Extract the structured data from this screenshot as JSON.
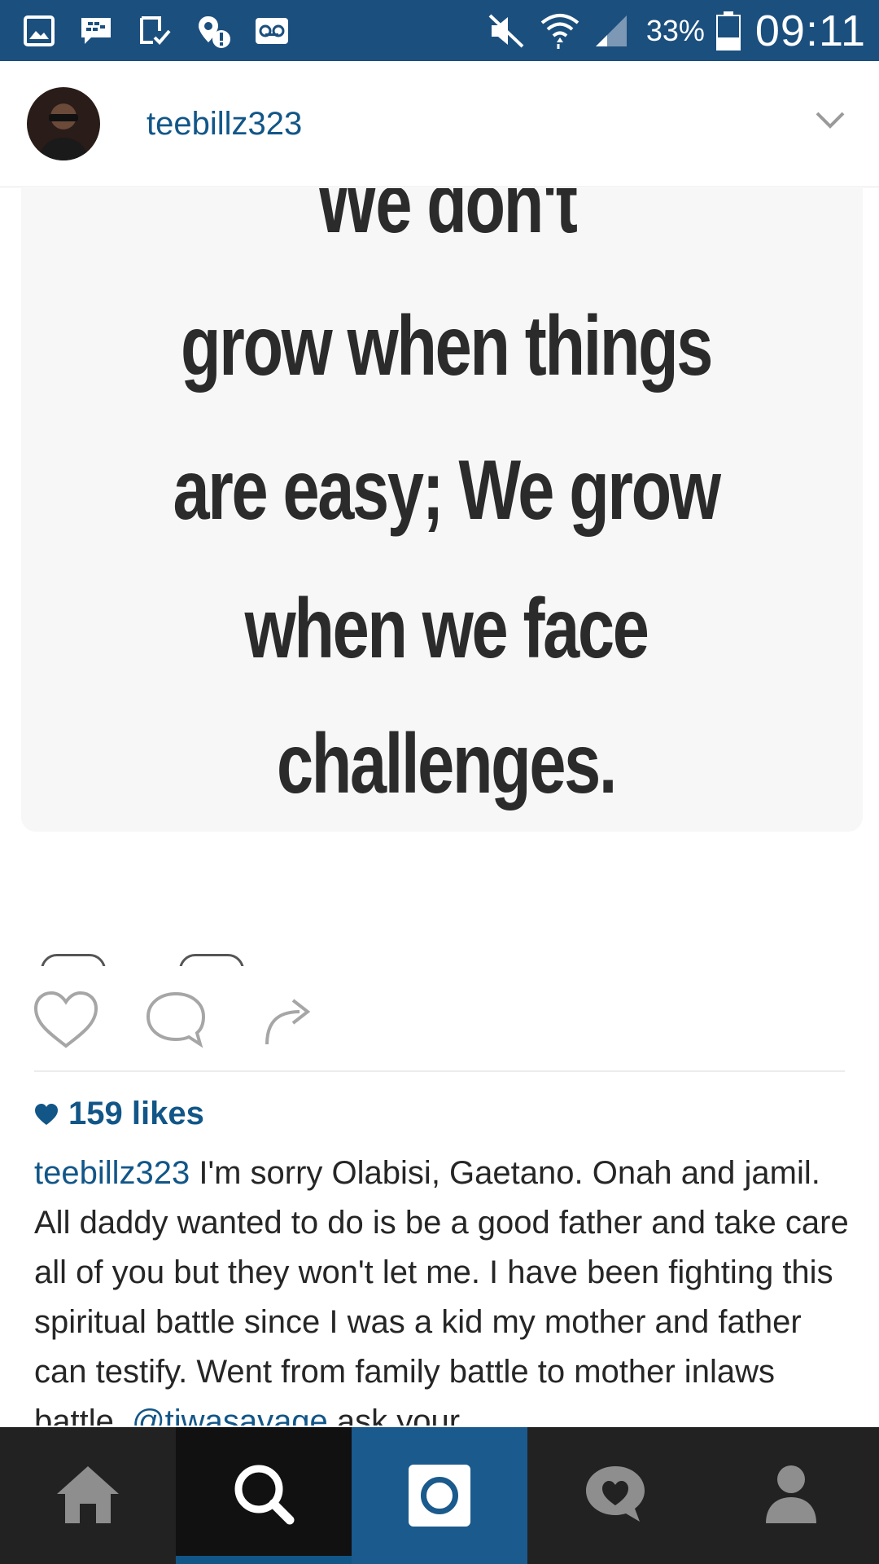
{
  "status_bar": {
    "left_icons": [
      "gallery-icon",
      "bbm-icon",
      "download-done-icon",
      "location-alert-icon",
      "voicemail-icon"
    ],
    "right_icons": [
      "mute-icon",
      "wifi-icon",
      "signal-icon",
      "battery-icon"
    ],
    "battery": "33%",
    "time": "09:11"
  },
  "post": {
    "username": "teebillz323",
    "image_quote_lines": [
      "We don't",
      "grow when things",
      "are easy; We grow",
      "when we face",
      "challenges."
    ],
    "likes": "159 likes",
    "caption_user": "teebillz323",
    "caption_text": " I'm sorry Olabisi, Gaetano. Onah and jamil. All daddy wanted to do is be a good father and take care all of you but they won't let me. I have been fighting this spiritual battle since I was a kid my mother and father can testify. Went from family battle to mother inlaws battle. ",
    "caption_mention": "@tiwasavage",
    "caption_tail": " ask your"
  },
  "bottom_nav": [
    "home-icon",
    "search-icon",
    "camera-icon",
    "activity-icon",
    "profile-icon"
  ],
  "colors": {
    "status_bar": "#1b4f7e",
    "link_blue": "#125688",
    "nav_bg": "#222222",
    "nav_active": "#111111",
    "camera_tab": "#1b5a8c"
  }
}
